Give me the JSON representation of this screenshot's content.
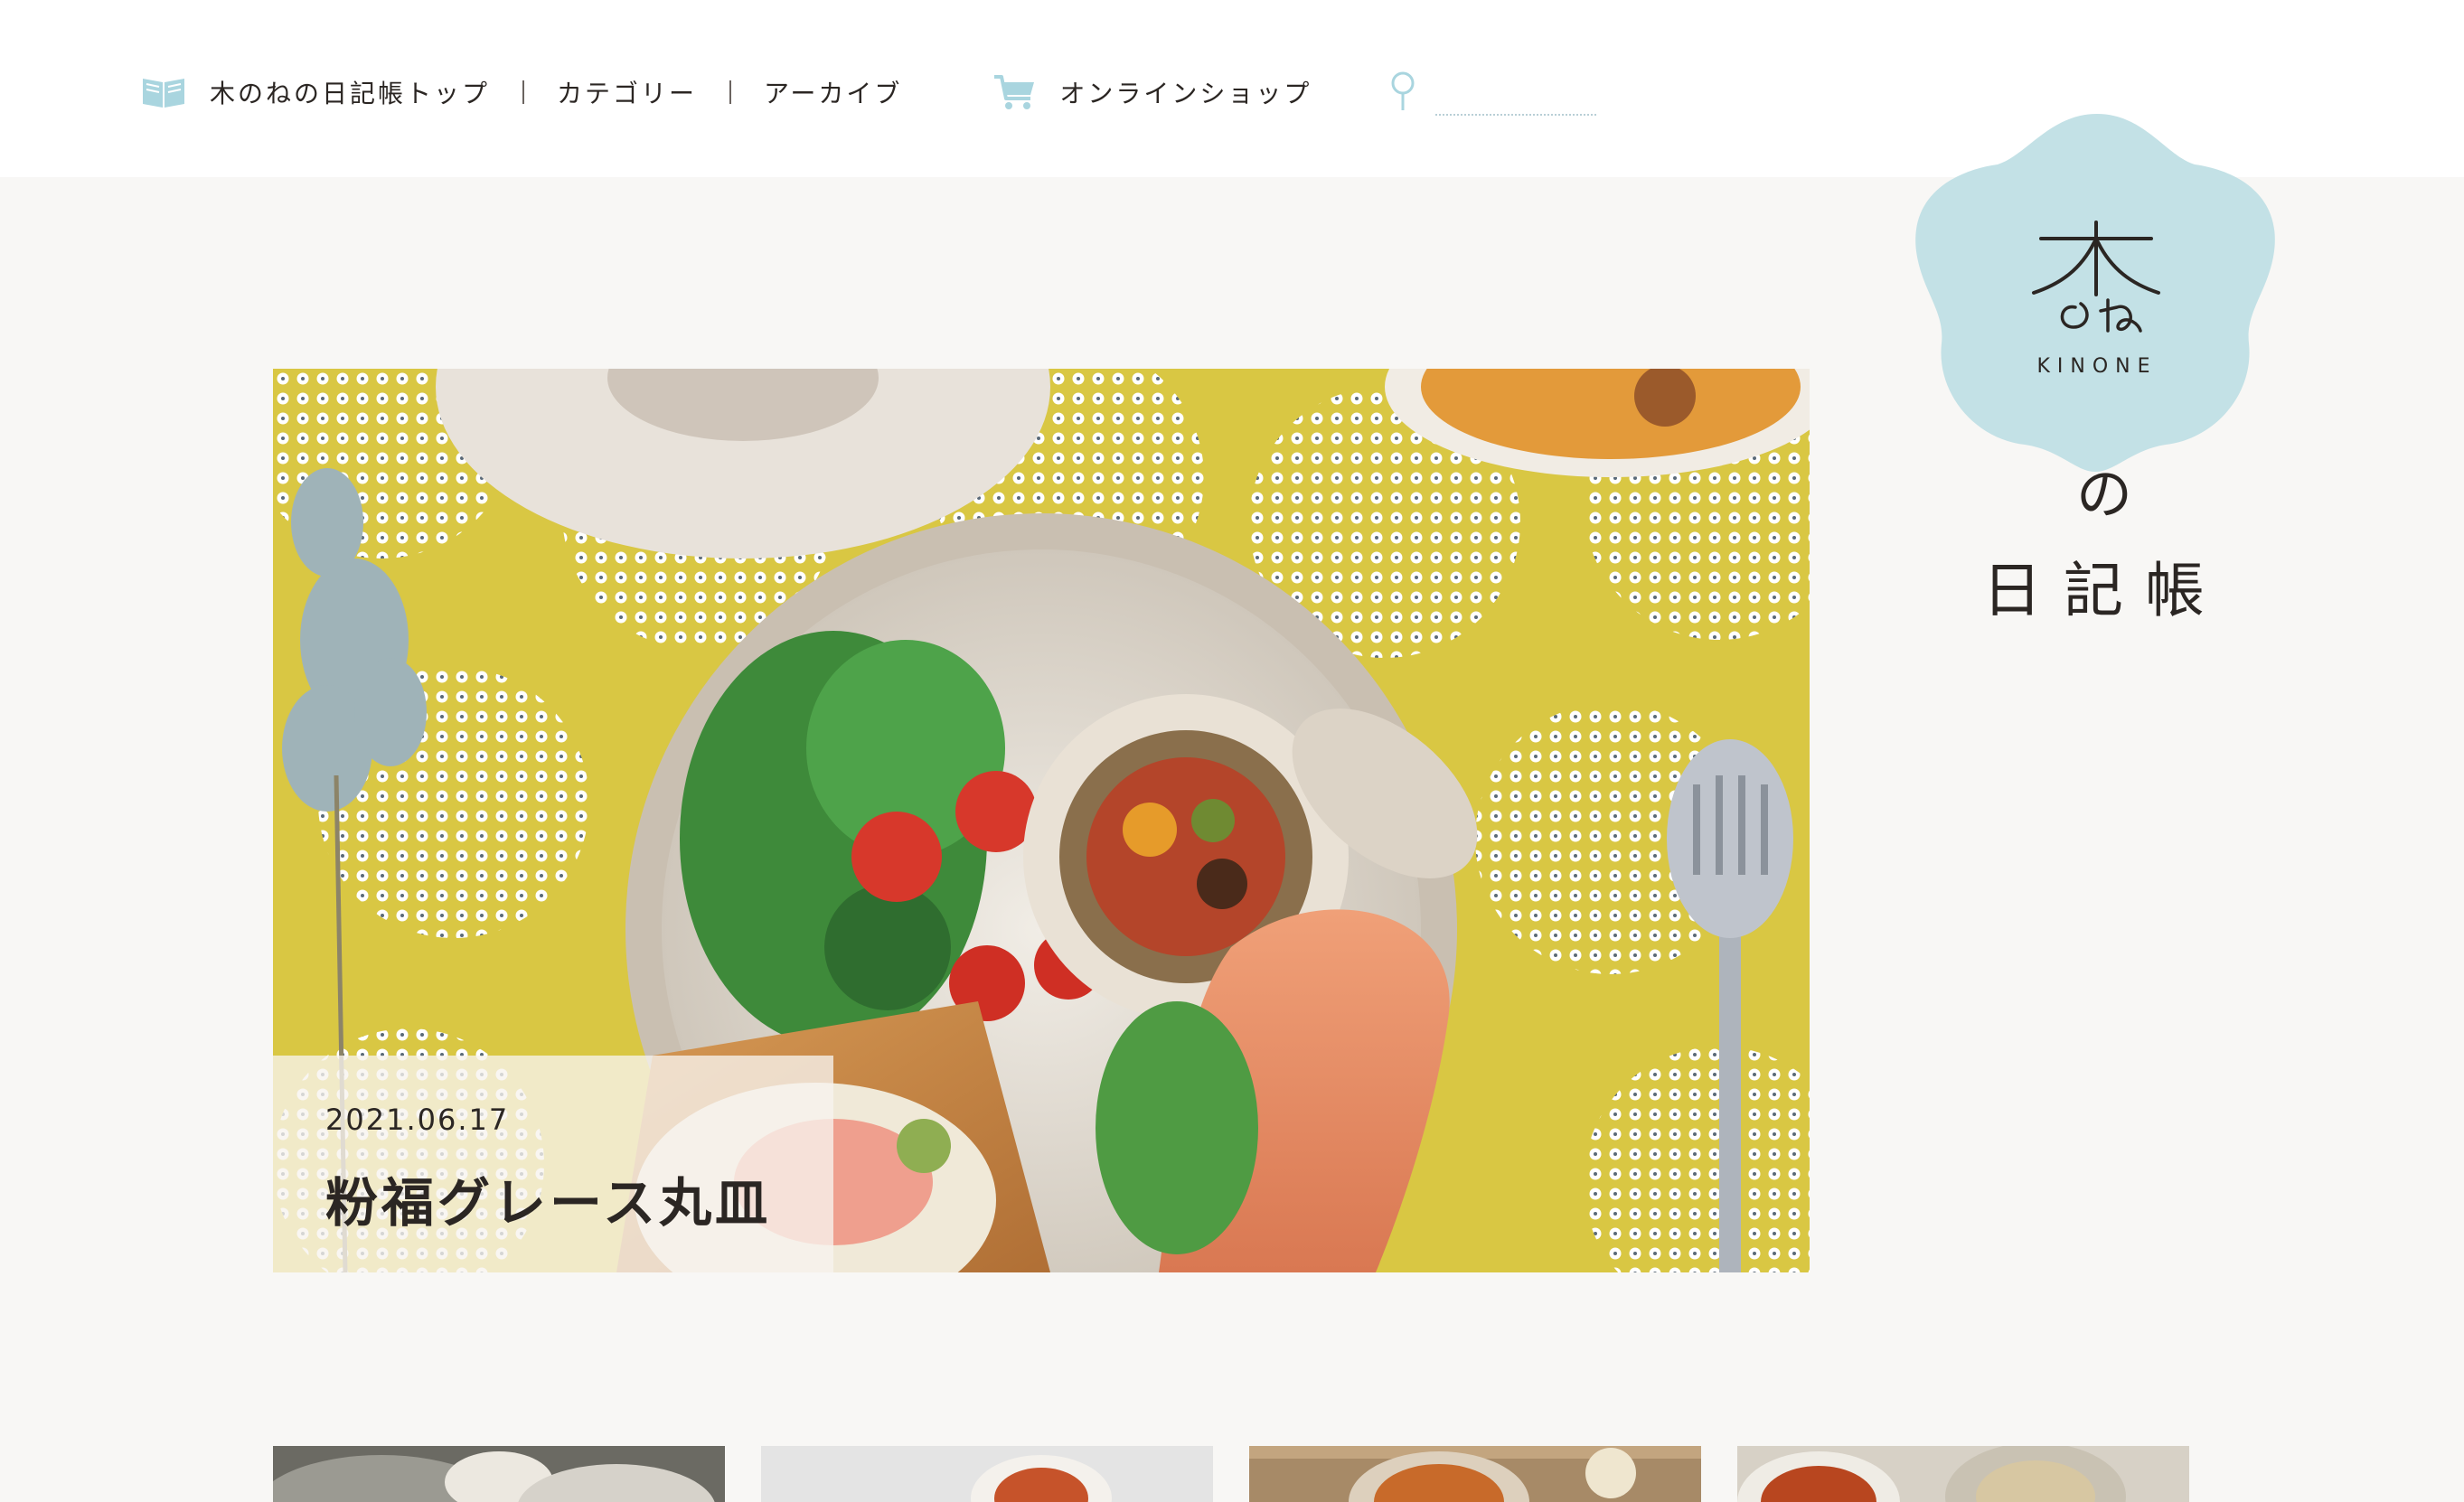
{
  "nav": {
    "items": [
      {
        "label": "木のねの日記帳トップ",
        "icon": "book-icon"
      },
      {
        "label": "カテゴリー"
      },
      {
        "label": "アーカイブ"
      }
    ],
    "shop": {
      "label": "オンラインショップ",
      "icon": "cart-icon"
    },
    "search": {
      "icon": "search-icon",
      "placeholder": ""
    }
  },
  "logo": {
    "brand_text": "KINONE",
    "word": "の",
    "title": "日記帳",
    "color": "#c3e1e6"
  },
  "hero": {
    "date": "2021.06.17",
    "title": "粉福グレース丸皿"
  },
  "colors": {
    "accent": "#9ccfd9",
    "tablecloth": "#d9c743",
    "background": "#f8f7f5"
  },
  "thumbnails": [
    {
      "name": "post-thumb-1"
    },
    {
      "name": "post-thumb-2"
    },
    {
      "name": "post-thumb-3"
    },
    {
      "name": "post-thumb-4"
    }
  ]
}
